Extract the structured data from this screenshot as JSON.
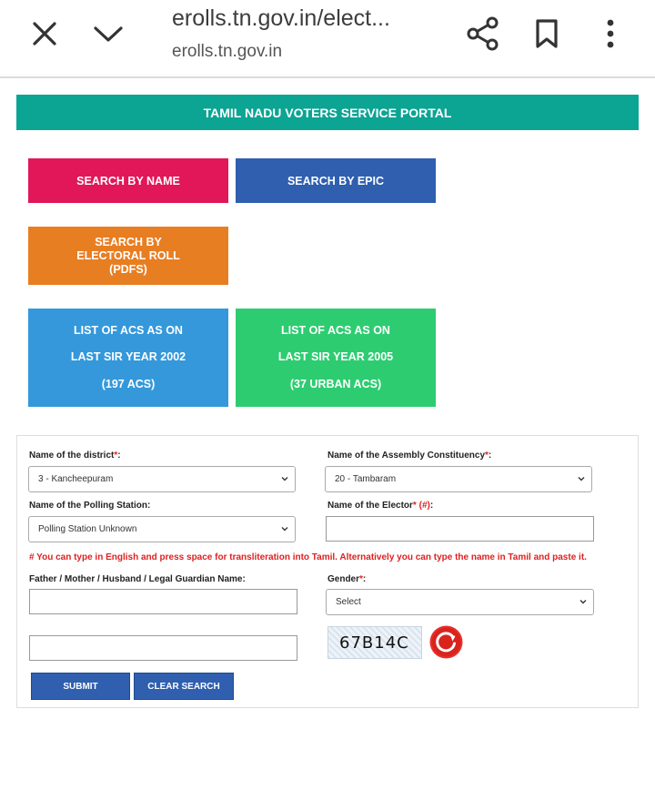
{
  "browser": {
    "url_title": "erolls.tn.gov.in/elect...",
    "domain": "erolls.tn.gov.in",
    "icons": [
      "close-icon",
      "chevron-down-icon",
      "share-icon",
      "bookmark-icon",
      "more-vert-icon"
    ]
  },
  "portal": {
    "title": "TAMIL NADU VOTERS SERVICE PORTAL",
    "colors": {
      "banner": "#0ca493",
      "search_by_name": "#e1175a",
      "search_by_epic": "#2f5fae",
      "electoral_roll": "#e87e22",
      "acs_2002": "#3498db",
      "acs_2005": "#2ecc71"
    }
  },
  "tiles": {
    "search_by_name": "SEARCH BY NAME",
    "search_by_epic": "SEARCH BY EPIC",
    "electoral_roll": [
      "SEARCH BY",
      "ELECTORAL ROLL",
      "(PDFS)"
    ],
    "acs_2002": [
      "LIST OF ACS AS ON",
      "LAST SIR YEAR 2002",
      "(197 ACS)"
    ],
    "acs_2005": [
      "LIST OF ACS AS ON",
      "LAST SIR YEAR 2005",
      "(37 URBAN ACS)"
    ]
  },
  "form": {
    "district_label": "Name of the district",
    "district_value": "3 - Kancheepuram",
    "ac_label": "Name of the Assembly Constituency",
    "ac_value": "20 - Tambaram",
    "ps_label": "Name of the Polling Station:",
    "ps_value": "Polling Station Unknown",
    "elector_label": "Name of the Elector",
    "elector_value": "",
    "transliteration_note": "# You can type in English and press space for transliteration into Tamil. Alternatively you can type the name in Tamil and paste it.",
    "guardian_label": "Father / Mother / Husband / Legal Guardian Name:",
    "guardian_value": "",
    "gender_label": "Gender",
    "gender_value": "Select",
    "captcha_input_value": "",
    "captcha_text": "67B14C",
    "submit_label": "SUBMIT",
    "clear_label": "CLEAR SEARCH",
    "required_mark": "*",
    "hash_mark": "(#)",
    "colon": ":"
  }
}
